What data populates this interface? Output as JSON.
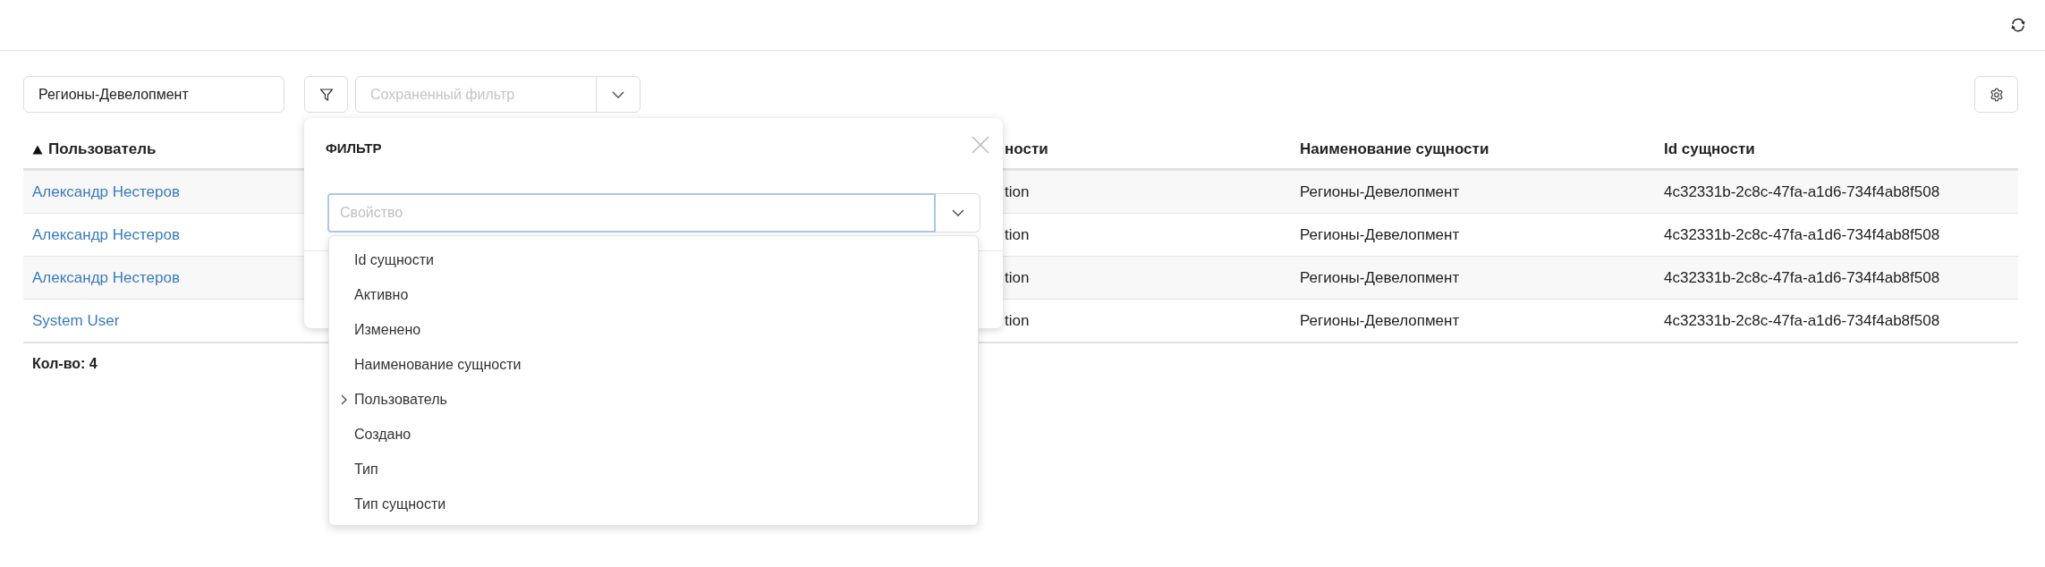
{
  "toolbar": {
    "search": {
      "value": "Регионы-Девелопмент"
    },
    "saved_filter": {
      "placeholder": "Сохраненный фильтр"
    }
  },
  "table": {
    "columns": [
      {
        "label": "Пользователь",
        "sorted": true
      },
      {
        "label": "ности",
        "sorted": false
      },
      {
        "label": "Наименование сущности",
        "sorted": false
      },
      {
        "label": "Id сущности",
        "sorted": false
      }
    ],
    "rows": [
      {
        "cells": [
          "Александр Нестеров",
          "tion",
          "Регионы-Девелопмент",
          "4c32331b-2c8c-47fa-a1d6-734f4ab8f508"
        ]
      },
      {
        "cells": [
          "Александр Нестеров",
          "tion",
          "Регионы-Девелопмент",
          "4c32331b-2c8c-47fa-a1d6-734f4ab8f508"
        ]
      },
      {
        "cells": [
          "Александр Нестеров",
          "tion",
          "Регионы-Девелопмент",
          "4c32331b-2c8c-47fa-a1d6-734f4ab8f508"
        ]
      },
      {
        "cells": [
          "System User",
          "tion",
          "Регионы-Девелопмент",
          "4c32331b-2c8c-47fa-a1d6-734f4ab8f508"
        ]
      }
    ],
    "count": "Кол-во: 4"
  },
  "filter_popup": {
    "title": "ФИЛЬТР",
    "property_field": {
      "placeholder": "Свойство",
      "focused": true
    },
    "options": [
      {
        "label": "Id сущности",
        "kind": "field",
        "selected": false
      },
      {
        "label": "Активно",
        "kind": "field",
        "selected": false
      },
      {
        "label": "Изменено",
        "kind": "field",
        "selected": false
      },
      {
        "label": "Наименование сущности",
        "kind": "field",
        "selected": false
      },
      {
        "label": "Пользователь",
        "kind": "group",
        "selected": false
      },
      {
        "label": "Создано",
        "kind": "field",
        "selected": false
      },
      {
        "label": "Тип",
        "kind": "field",
        "selected": false
      },
      {
        "label": "Тип сущности",
        "kind": "field",
        "selected": false
      }
    ]
  }
}
